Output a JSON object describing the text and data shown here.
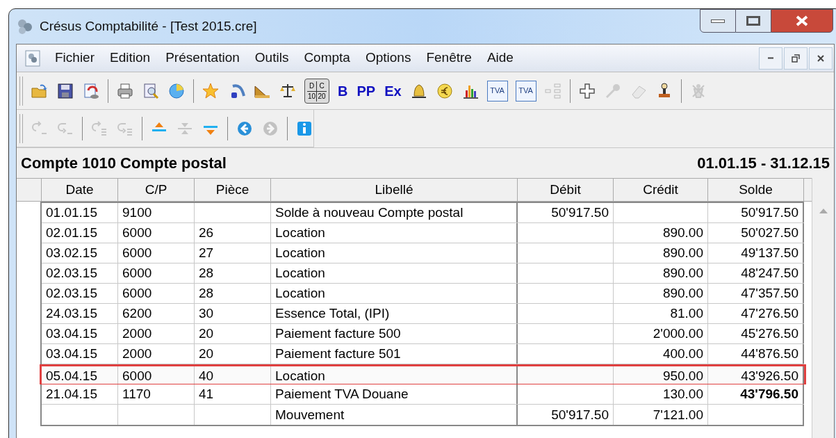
{
  "window": {
    "title": "Crésus Comptabilité - [Test 2015.cre]"
  },
  "menu": [
    {
      "label": "Fichier"
    },
    {
      "label": "Edition"
    },
    {
      "label": "Présentation"
    },
    {
      "label": "Outils"
    },
    {
      "label": "Compta"
    },
    {
      "label": "Options"
    },
    {
      "label": "Fenêtre"
    },
    {
      "label": "Aide"
    }
  ],
  "toolbars": [
    {
      "items": [
        {
          "kind": "icon",
          "disabled": false
        },
        {
          "kind": "icon",
          "disabled": false
        },
        {
          "kind": "icon",
          "disabled": false
        },
        {
          "kind": "separator"
        },
        {
          "kind": "icon",
          "disabled": false
        },
        {
          "kind": "icon",
          "disabled": false
        },
        {
          "kind": "icon",
          "disabled": false
        },
        {
          "kind": "separator"
        },
        {
          "kind": "icon",
          "disabled": false
        },
        {
          "kind": "icon",
          "disabled": false
        },
        {
          "kind": "icon",
          "disabled": false
        },
        {
          "kind": "icon",
          "disabled": false
        },
        {
          "kind": "grid",
          "pressed": true,
          "labels": [
            "D",
            "C",
            "10",
            "20"
          ]
        },
        {
          "kind": "text",
          "label": "B"
        },
        {
          "kind": "text",
          "label": "PP"
        },
        {
          "kind": "text",
          "label": "Ex"
        },
        {
          "kind": "icon",
          "disabled": false
        },
        {
          "kind": "icon",
          "disabled": false
        },
        {
          "kind": "icon",
          "disabled": false
        },
        {
          "kind": "labelled",
          "label": "TVA"
        },
        {
          "kind": "labelled",
          "label": "TVA"
        },
        {
          "kind": "icon",
          "disabled": true
        },
        {
          "kind": "separator"
        },
        {
          "kind": "icon",
          "disabled": false
        },
        {
          "kind": "icon",
          "disabled": true
        },
        {
          "kind": "icon",
          "disabled": true
        },
        {
          "kind": "icon",
          "disabled": false
        },
        {
          "kind": "separator"
        },
        {
          "kind": "icon",
          "disabled": true
        }
      ]
    },
    {
      "items": [
        {
          "kind": "icon",
          "disabled": true
        },
        {
          "kind": "icon",
          "disabled": true
        },
        {
          "kind": "separator"
        },
        {
          "kind": "icon",
          "disabled": true
        },
        {
          "kind": "icon",
          "disabled": true
        },
        {
          "kind": "separator"
        },
        {
          "kind": "icon",
          "disabled": false
        },
        {
          "kind": "icon",
          "disabled": true
        },
        {
          "kind": "icon",
          "disabled": false
        },
        {
          "kind": "separator"
        },
        {
          "kind": "icon",
          "disabled": false
        },
        {
          "kind": "icon",
          "disabled": true
        },
        {
          "kind": "separator"
        },
        {
          "kind": "icon",
          "disabled": false
        }
      ]
    }
  ],
  "account": {
    "title": "Compte 1010 Compte postal",
    "period": "01.01.15 - 31.12.15"
  },
  "table": {
    "columns": [
      "Date",
      "C/P",
      "Pièce",
      "Libellé",
      "Débit",
      "Crédit",
      "Solde"
    ],
    "rows": [
      {
        "date": "01.01.15",
        "cp": "9100",
        "piece": "",
        "libelle": "Solde à nouveau Compte postal",
        "debit": "50'917.50",
        "credit": "",
        "solde": "50'917.50",
        "highlighted": false,
        "solde_bold": false
      },
      {
        "date": "02.01.15",
        "cp": "6000",
        "piece": "26",
        "libelle": "Location",
        "debit": "",
        "credit": "890.00",
        "solde": "50'027.50",
        "highlighted": false,
        "solde_bold": false
      },
      {
        "date": "03.02.15",
        "cp": "6000",
        "piece": "27",
        "libelle": "Location",
        "debit": "",
        "credit": "890.00",
        "solde": "49'137.50",
        "highlighted": false,
        "solde_bold": false
      },
      {
        "date": "02.03.15",
        "cp": "6000",
        "piece": "28",
        "libelle": "Location",
        "debit": "",
        "credit": "890.00",
        "solde": "48'247.50",
        "highlighted": false,
        "solde_bold": false
      },
      {
        "date": "02.03.15",
        "cp": "6000",
        "piece": "28",
        "libelle": "Location",
        "debit": "",
        "credit": "890.00",
        "solde": "47'357.50",
        "highlighted": false,
        "solde_bold": false
      },
      {
        "date": "24.03.15",
        "cp": "6200",
        "piece": "30",
        "libelle": "Essence Total, (IPI)",
        "debit": "",
        "credit": "81.00",
        "solde": "47'276.50",
        "highlighted": false,
        "solde_bold": false
      },
      {
        "date": "03.04.15",
        "cp": "2000",
        "piece": "20",
        "libelle": "Paiement facture 500",
        "debit": "",
        "credit": "2'000.00",
        "solde": "45'276.50",
        "highlighted": false,
        "solde_bold": false
      },
      {
        "date": "03.04.15",
        "cp": "2000",
        "piece": "20",
        "libelle": "Paiement facture 501",
        "debit": "",
        "credit": "400.00",
        "solde": "44'876.50",
        "highlighted": false,
        "solde_bold": false
      },
      {
        "date": "05.04.15",
        "cp": "6000",
        "piece": "40",
        "libelle": "Location",
        "debit": "",
        "credit": "950.00",
        "solde": "43'926.50",
        "highlighted": true,
        "solde_bold": false
      },
      {
        "date": "21.04.15",
        "cp": "1170",
        "piece": "41",
        "libelle": "Paiement TVA Douane",
        "debit": "",
        "credit": "130.00",
        "solde": "43'796.50",
        "highlighted": false,
        "solde_bold": true
      }
    ],
    "total": {
      "libelle": "Mouvement",
      "debit": "50'917.50",
      "credit": "7'121.00"
    }
  }
}
